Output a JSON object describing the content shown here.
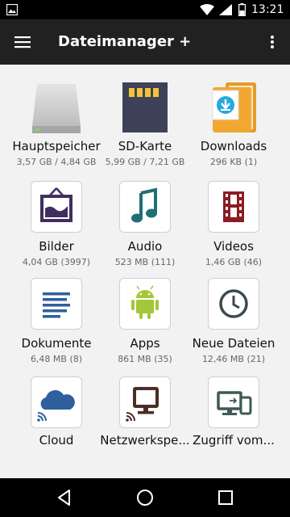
{
  "status_bar": {
    "time": "13:21",
    "icons": [
      "image-notification-icon",
      "wifi-icon",
      "signal-icon",
      "battery-icon"
    ]
  },
  "app_bar": {
    "title": "Dateimanager +",
    "icons": [
      "hamburger-menu-icon",
      "more-vert-icon"
    ]
  },
  "tiles": [
    {
      "label": "Hauptspeicher",
      "meta": "3,57 GB / 4,84 GB",
      "icon": "hard-drive-icon"
    },
    {
      "label": "SD-Karte",
      "meta": "5,99 GB / 7,21 GB",
      "icon": "sd-card-icon"
    },
    {
      "label": "Downloads",
      "meta": "296 KB (1)",
      "icon": "downloads-folder-icon"
    },
    {
      "label": "Bilder",
      "meta": "4,04 GB (3997)",
      "icon": "picture-frame-icon"
    },
    {
      "label": "Audio",
      "meta": "523 MB (111)",
      "icon": "music-note-icon"
    },
    {
      "label": "Videos",
      "meta": "1,46 GB (46)",
      "icon": "film-strip-icon"
    },
    {
      "label": "Dokumente",
      "meta": "6,48 MB (8)",
      "icon": "document-lines-icon"
    },
    {
      "label": "Apps",
      "meta": "861 MB (35)",
      "icon": "android-icon"
    },
    {
      "label": "Neue Dateien",
      "meta": "12,46 MB (21)",
      "icon": "clock-icon"
    },
    {
      "label": "Cloud",
      "meta": "",
      "icon": "cloud-icon"
    },
    {
      "label": "Netzwerkspe...",
      "meta": "",
      "icon": "network-monitor-icon"
    },
    {
      "label": "Zugriff vom...",
      "meta": "",
      "icon": "remote-devices-icon"
    }
  ],
  "colors": {
    "app_bar": "#212121",
    "background": "#f2f2f2",
    "accent_blue": "#2f5f9c",
    "accent_teal": "#1f6f74",
    "accent_red": "#8b1c24",
    "android_green": "#a4c639",
    "folder_orange": "#f0a830"
  },
  "nav_bar": {
    "icons": [
      "back-triangle-icon",
      "home-circle-icon",
      "recents-square-icon"
    ]
  }
}
